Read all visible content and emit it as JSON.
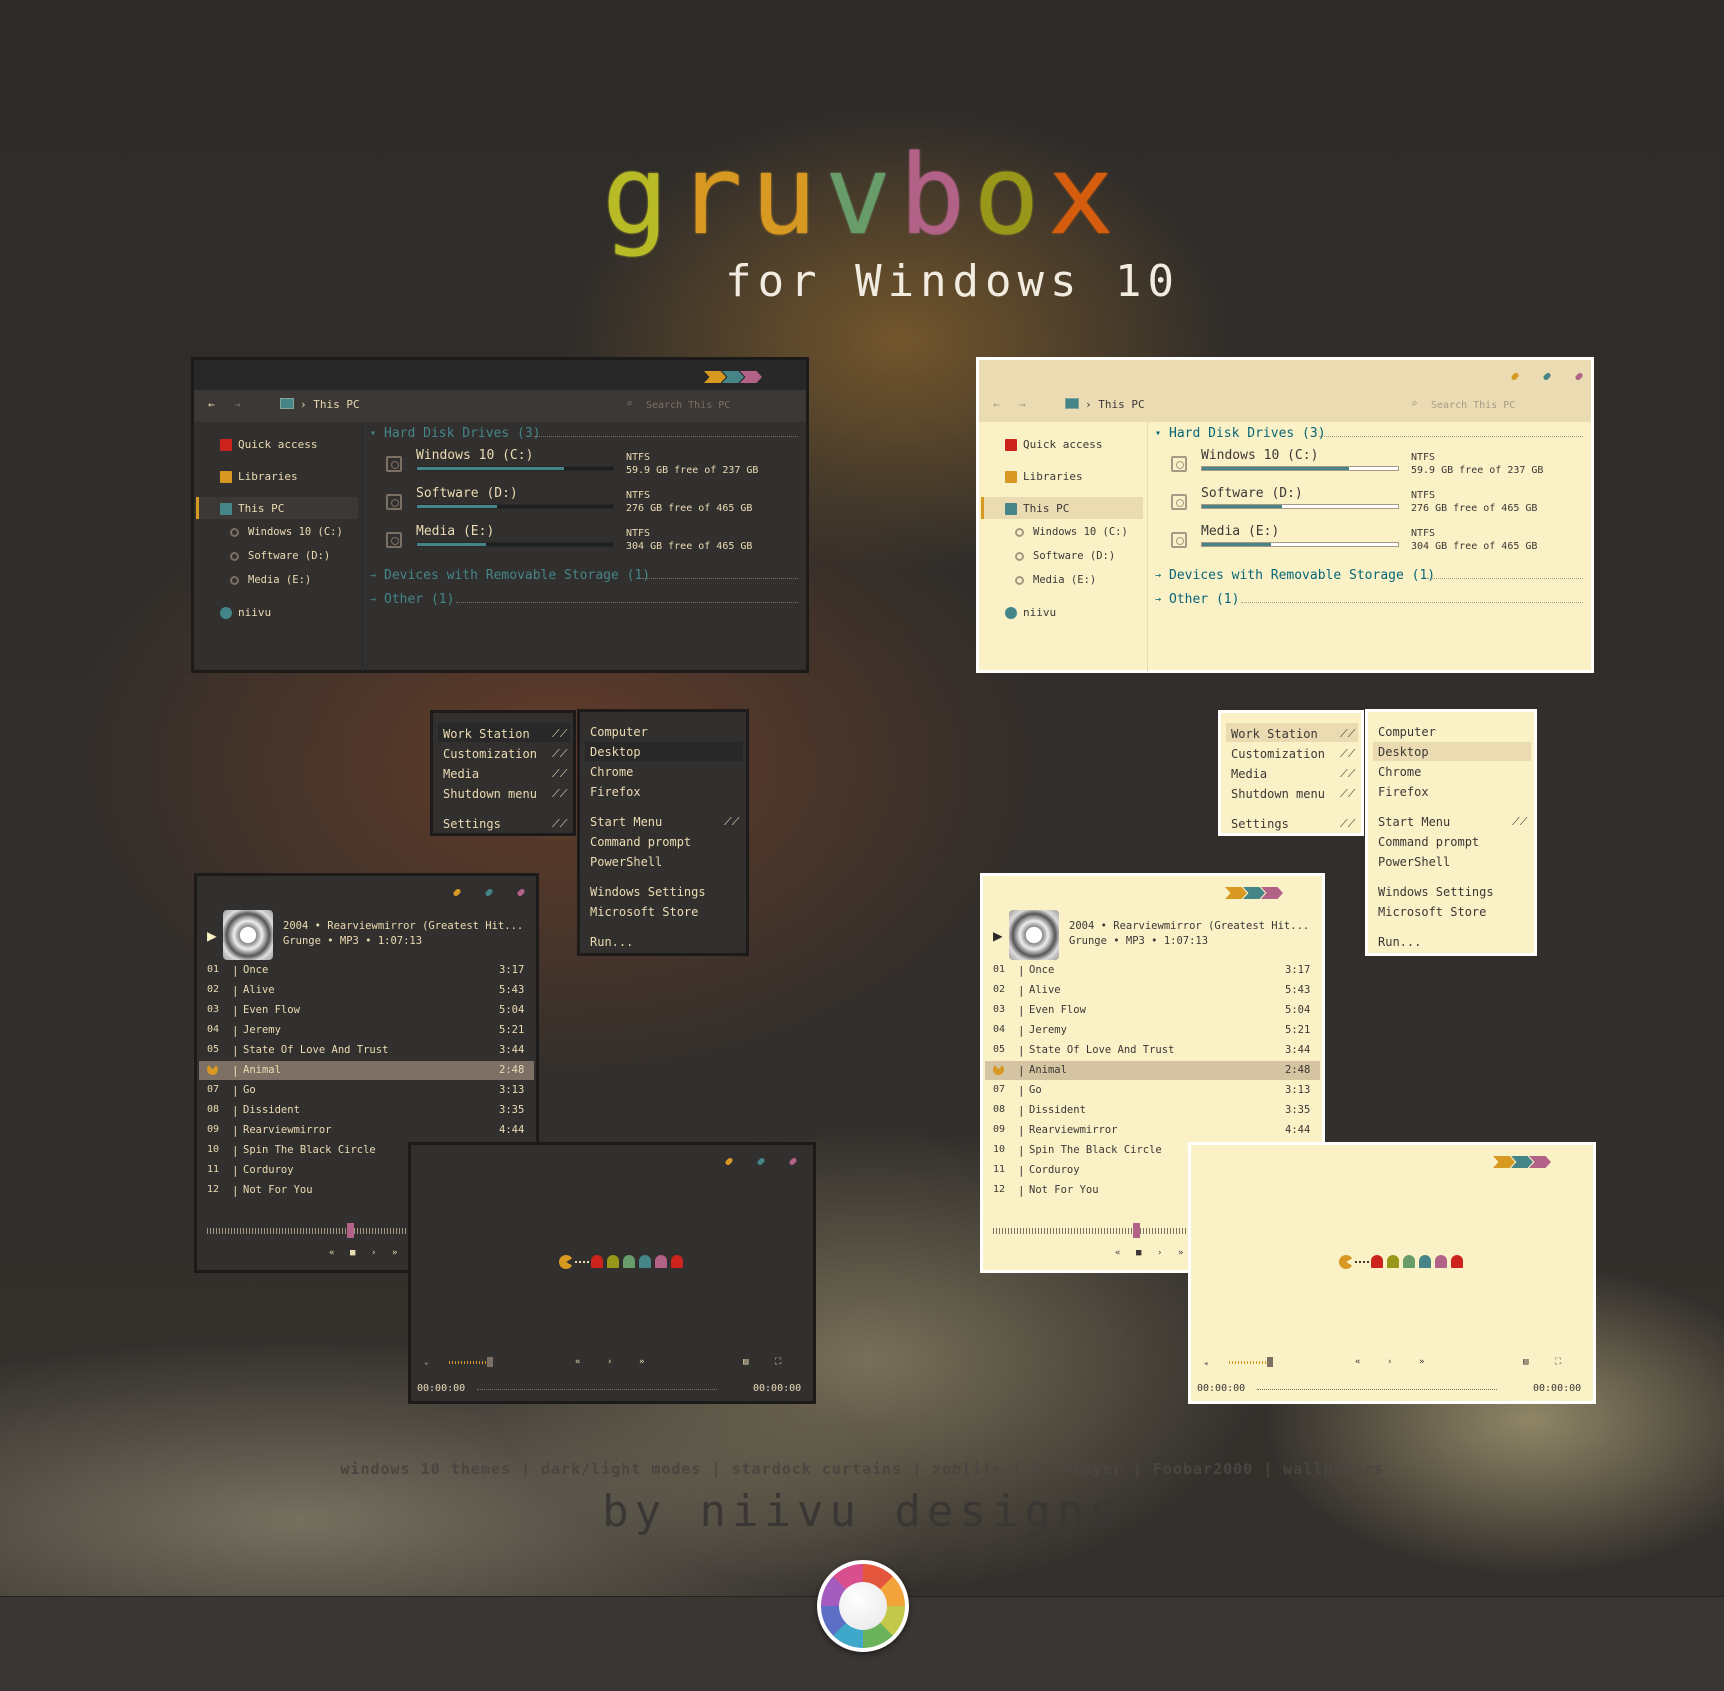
{
  "header": {
    "title_letters": [
      {
        "ch": "g",
        "color": "#b8bb26"
      },
      {
        "ch": "r",
        "color": "#d79921"
      },
      {
        "ch": "u",
        "color": "#d79921"
      },
      {
        "ch": "v",
        "color": "#689d6a"
      },
      {
        "ch": "b",
        "color": "#b16286"
      },
      {
        "ch": "o",
        "color": "#98971a"
      },
      {
        "ch": "x",
        "color": "#d65d0e"
      }
    ],
    "subtitle": "for Windows 10"
  },
  "accent_colors": {
    "yellow": "#d79921",
    "aqua": "#458588",
    "purple": "#b16286"
  },
  "explorer": {
    "location": "› This PC",
    "search_placeholder": "Search This PC",
    "sidebar": [
      {
        "label": "Quick access",
        "icon": "bookmark-icon"
      },
      {
        "label": "Libraries",
        "icon": "library-icon"
      },
      {
        "label": "This PC",
        "icon": "computer-icon"
      },
      {
        "label": "Windows 10 (C:)",
        "icon": "drive-icon"
      },
      {
        "label": "Software (D:)",
        "icon": "drive-icon"
      },
      {
        "label": "Media (E:)",
        "icon": "drive-icon"
      },
      {
        "label": "niivu",
        "icon": "user-icon"
      }
    ],
    "sections": {
      "hdd": "Hard Disk Drives (3)",
      "removable": "Devices with Removable Storage (1)",
      "other": "Other (1)"
    },
    "drives": [
      {
        "name": "Windows 10 (C:)",
        "fs": "NTFS",
        "free": "59.9 GB free of 237 GB",
        "used": 0.75
      },
      {
        "name": "Software (D:)",
        "fs": "NTFS",
        "free": "276 GB free of 465 GB",
        "used": 0.41
      },
      {
        "name": "Media (E:)",
        "fs": "NTFS",
        "free": "304 GB free of 465 GB",
        "used": 0.35
      }
    ]
  },
  "menu": {
    "left": [
      "Work Station",
      "Customization",
      "Media",
      "Shutdown menu",
      "Settings"
    ],
    "right": [
      "Computer",
      "Desktop",
      "Chrome",
      "Firefox",
      "Start Menu",
      "Command prompt",
      "PowerShell",
      "Windows Settings",
      "Microsoft Store",
      "Run..."
    ]
  },
  "player": {
    "album_line": "2004 • Rearviewmirror (Greatest Hit...",
    "meta_line": "Grunge • MP3 • 1:07:13",
    "tracks": [
      {
        "no": "01",
        "title": "Once",
        "time": "3:17"
      },
      {
        "no": "02",
        "title": "Alive",
        "time": "5:43"
      },
      {
        "no": "03",
        "title": "Even Flow",
        "time": "5:04"
      },
      {
        "no": "04",
        "title": "Jeremy",
        "time": "5:21"
      },
      {
        "no": "05",
        "title": "State Of Love And Trust",
        "time": "3:44"
      },
      {
        "no": "",
        "title": "Animal",
        "time": "2:48"
      },
      {
        "no": "07",
        "title": "Go",
        "time": "3:13"
      },
      {
        "no": "08",
        "title": "Dissident",
        "time": "3:35"
      },
      {
        "no": "09",
        "title": "Rearviewmirror",
        "time": "4:44"
      },
      {
        "no": "10",
        "title": "Spin The Black Circle",
        "time": ""
      },
      {
        "no": "11",
        "title": "Corduroy",
        "time": ""
      },
      {
        "no": "12",
        "title": "Not For You",
        "time": ""
      }
    ]
  },
  "video": {
    "time_left": "00:00:00",
    "time_right": "00:00:00",
    "ghost_colors": [
      "#cc241d",
      "#98971a",
      "#689d6a",
      "#458588",
      "#b16286",
      "#cc241d"
    ]
  },
  "footer": {
    "tags": "windows 10 themes | dark/light modes | stardock curtains | xoblite | PotPlayer | Foobar2000 | wallpapers",
    "byline": "by niivu designs"
  }
}
